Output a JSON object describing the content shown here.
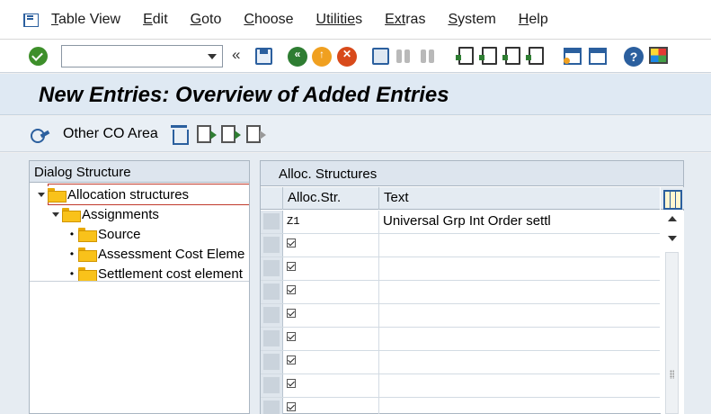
{
  "menu": {
    "items": [
      {
        "label": "Table View",
        "u": "T",
        "rest": "able View"
      },
      {
        "label": "Edit",
        "u": "E",
        "rest": "dit"
      },
      {
        "label": "Goto",
        "u": "G",
        "rest": "oto"
      },
      {
        "label": "Choose",
        "u": "C",
        "rest": "hoose"
      },
      {
        "label": "Utilities",
        "u": "Utilitie",
        "rest": "s"
      },
      {
        "label": "Extras",
        "u": "Ext",
        "rest": "ras"
      },
      {
        "label": "System",
        "u": "S",
        "rest": "ystem"
      },
      {
        "label": "Help",
        "u": "H",
        "rest": "elp"
      }
    ]
  },
  "toolbar": {
    "command_field_value": "",
    "prev_glyph": "«"
  },
  "title": "New Entries: Overview of Added Entries",
  "app_toolbar": {
    "other_co_area_label": "Other CO Area"
  },
  "dialog_structure": {
    "header": "Dialog Structure",
    "nodes": [
      {
        "label": "Allocation structures",
        "level": 0,
        "expanded": true,
        "selected": true
      },
      {
        "label": "Assignments",
        "level": 1,
        "expanded": true
      },
      {
        "label": "Source",
        "level": 2
      },
      {
        "label": "Assessment Cost Eleme",
        "level": 2
      },
      {
        "label": "Settlement cost element",
        "level": 2
      }
    ]
  },
  "table": {
    "title": "Alloc. Structures",
    "columns": {
      "alloc_str": "Alloc.Str.",
      "text": "Text"
    },
    "rows": [
      {
        "alloc_str": "Z1",
        "text": "Universal Grp Int Order settl"
      },
      {
        "alloc_str": "",
        "text": ""
      },
      {
        "alloc_str": "",
        "text": ""
      },
      {
        "alloc_str": "",
        "text": ""
      },
      {
        "alloc_str": "",
        "text": ""
      },
      {
        "alloc_str": "",
        "text": ""
      },
      {
        "alloc_str": "",
        "text": ""
      },
      {
        "alloc_str": "",
        "text": ""
      },
      {
        "alloc_str": "",
        "text": ""
      }
    ]
  },
  "colors": {
    "title_bg": "#dfe9f3",
    "accent_blue": "#2b5f9e",
    "folder_yellow": "#f9c21a",
    "ok_green": "#3d8f2a"
  }
}
